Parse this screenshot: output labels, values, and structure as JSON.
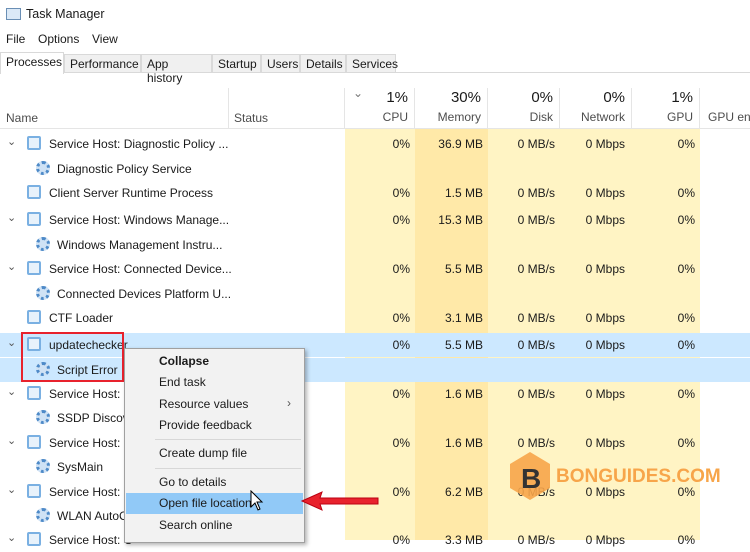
{
  "window": {
    "title": "Task Manager"
  },
  "menu": [
    "File",
    "Options",
    "View"
  ],
  "tabs": [
    "Processes",
    "Performance",
    "App history",
    "Startup",
    "Users",
    "Details",
    "Services"
  ],
  "header": {
    "name": "Name",
    "status": "Status",
    "columns": [
      {
        "pct": "1%",
        "label": "CPU"
      },
      {
        "pct": "30%",
        "label": "Memory"
      },
      {
        "pct": "0%",
        "label": "Disk"
      },
      {
        "pct": "0%",
        "label": "Network"
      },
      {
        "pct": "1%",
        "label": "GPU"
      },
      {
        "pct": "",
        "label": "GPU eng"
      }
    ]
  },
  "rows": [
    {
      "name": "Service Host: Diagnostic Policy ...",
      "cpu": "0%",
      "mem": "36.9 MB",
      "disk": "0 MB/s",
      "net": "0 Mbps",
      "gpu": "0%"
    },
    {
      "name": "Diagnostic Policy Service",
      "child": true
    },
    {
      "name": "Client Server Runtime Process",
      "cpu": "0%",
      "mem": "1.5 MB",
      "disk": "0 MB/s",
      "net": "0 Mbps",
      "gpu": "0%"
    },
    {
      "name": "Service Host: Windows Manage...",
      "cpu": "0%",
      "mem": "15.3 MB",
      "disk": "0 MB/s",
      "net": "0 Mbps",
      "gpu": "0%"
    },
    {
      "name": "Windows Management Instru...",
      "child": true
    },
    {
      "name": "Service Host: Connected Device...",
      "cpu": "0%",
      "mem": "5.5 MB",
      "disk": "0 MB/s",
      "net": "0 Mbps",
      "gpu": "0%"
    },
    {
      "name": "Connected Devices Platform U...",
      "child": true
    },
    {
      "name": "CTF Loader",
      "cpu": "0%",
      "mem": "3.1 MB",
      "disk": "0 MB/s",
      "net": "0 Mbps",
      "gpu": "0%"
    },
    {
      "name": "updatechecker",
      "cpu": "0%",
      "mem": "5.5 MB",
      "disk": "0 MB/s",
      "net": "0 Mbps",
      "gpu": "0%"
    },
    {
      "name": "Script Error",
      "child": true
    },
    {
      "name": "Service Host: S",
      "cpu": "0%",
      "mem": "1.6 MB",
      "disk": "0 MB/s",
      "net": "0 Mbps",
      "gpu": "0%"
    },
    {
      "name": "SSDP Discove",
      "child": true
    },
    {
      "name": "Service Host: S",
      "cpu": "0%",
      "mem": "1.6 MB",
      "disk": "0 MB/s",
      "net": "0 Mbps",
      "gpu": "0%"
    },
    {
      "name": "SysMain",
      "child": true
    },
    {
      "name": "Service Host: L",
      "cpu": "0%",
      "mem": "6.2 MB",
      "disk": "0 MB/s",
      "net": "0 Mbps",
      "gpu": "0%"
    },
    {
      "name": "WLAN AutoC",
      "child": true
    },
    {
      "name": "Service Host: C",
      "cpu": "0%",
      "mem": "3.3 MB",
      "disk": "0 MB/s",
      "net": "0 Mbps",
      "gpu": "0%"
    }
  ],
  "context_menu": [
    "Collapse",
    "End task",
    "Resource values",
    "Provide feedback",
    "Create dump file",
    "Go to details",
    "Open file location",
    "Search online"
  ],
  "watermark": "BONGUIDES.COM",
  "colors": {
    "heat": "#fff4c4",
    "heat_mem": "#ffe9a8",
    "select": "#cce8ff",
    "highlight": "#91c9f7",
    "red": "#e8222d"
  }
}
